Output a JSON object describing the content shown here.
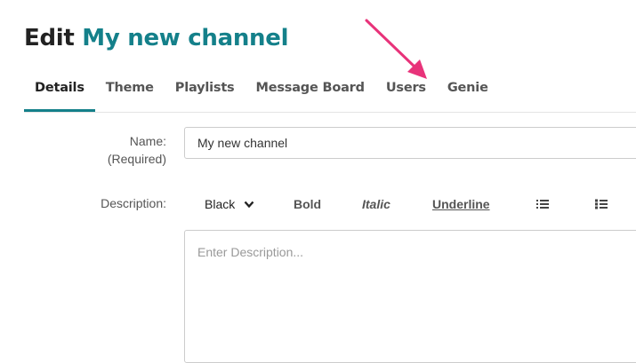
{
  "header": {
    "title_prefix": "Edit",
    "channel_name": "My new channel"
  },
  "tabs": [
    {
      "label": "Details",
      "active": true
    },
    {
      "label": "Theme",
      "active": false
    },
    {
      "label": "Playlists",
      "active": false
    },
    {
      "label": "Message Board",
      "active": false
    },
    {
      "label": "Users",
      "active": false
    },
    {
      "label": "Genie",
      "active": false
    }
  ],
  "form": {
    "name_label": "Name:",
    "name_required": "(Required)",
    "name_value": "My new channel",
    "description_label": "Description:",
    "description_placeholder": "Enter Description..."
  },
  "toolbar": {
    "color_select": "Black",
    "bold": "Bold",
    "italic": "Italic",
    "underline": "Underline",
    "icons": [
      "chevron-down-icon",
      "bullet-list-icon",
      "numbered-list-icon"
    ]
  },
  "colors": {
    "accent": "#14808a",
    "annotation_arrow": "#e8337a"
  }
}
